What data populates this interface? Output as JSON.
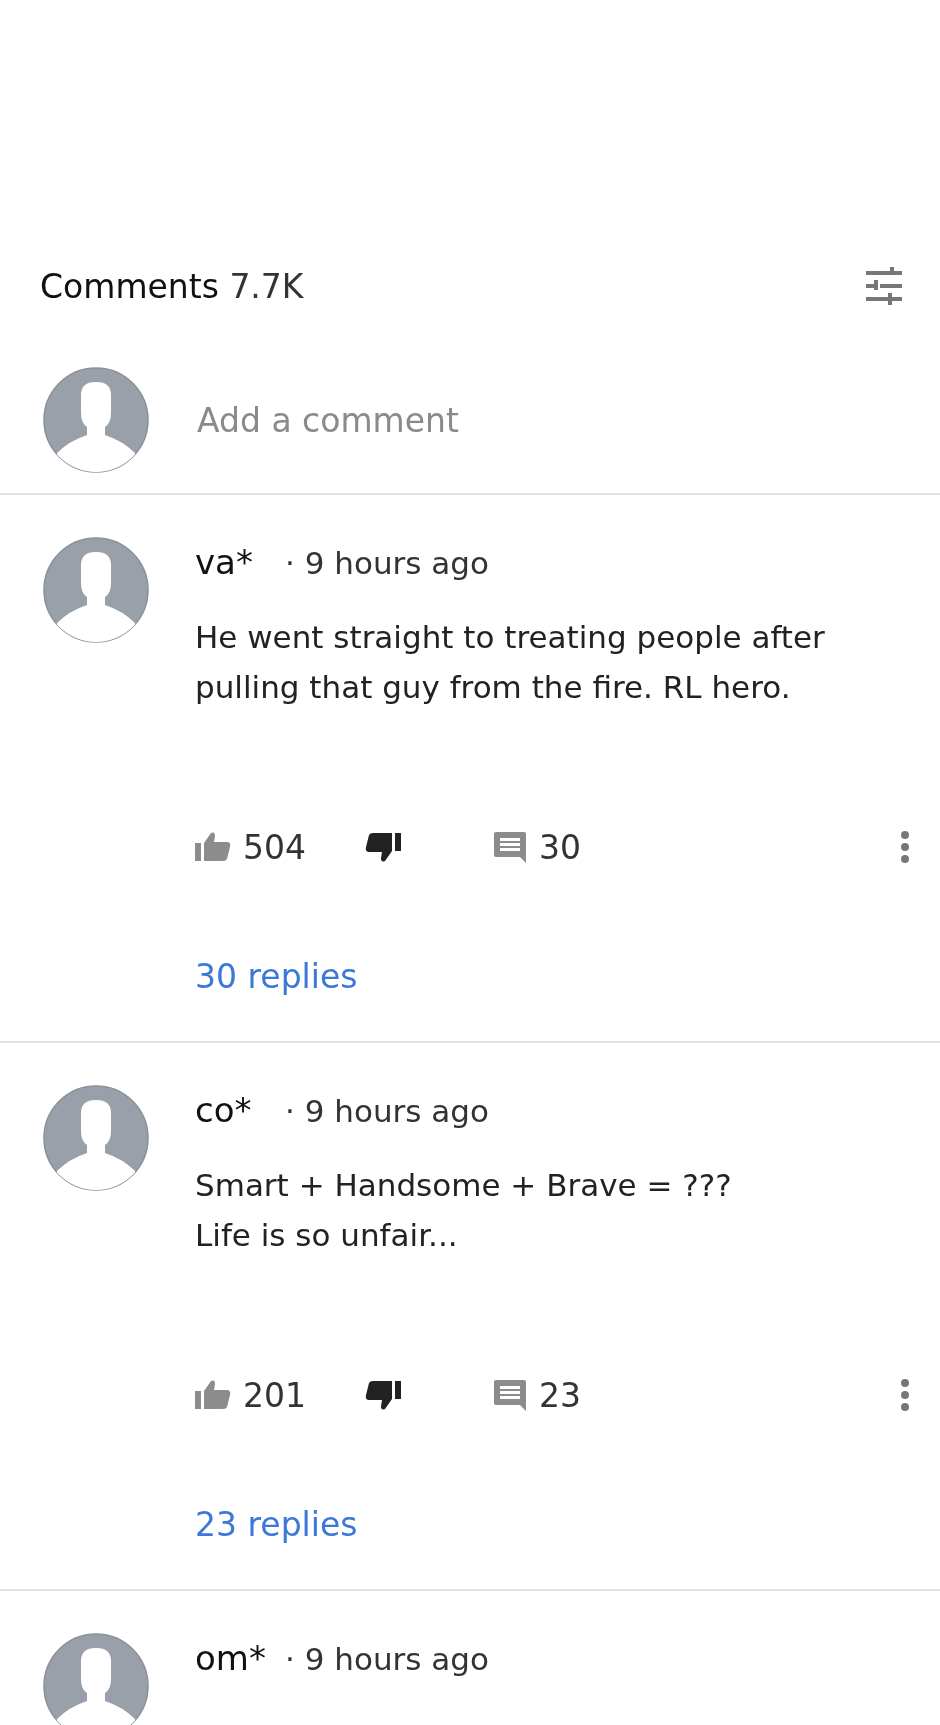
{
  "header": {
    "title": "Comments",
    "count": "7.7K"
  },
  "composer": {
    "placeholder": "Add a comment"
  },
  "comments": [
    {
      "author": "va*",
      "time": "· 9 hours ago",
      "text": "He went straight to treating people after pulling that guy from the fire. RL hero.",
      "likes": "504",
      "reply_count": "30",
      "replies_link": "30 replies"
    },
    {
      "author": "co*",
      "time": "· 9 hours ago",
      "text": "Smart + Handsome + Brave = ???\nLife is so unfair...",
      "likes": "201",
      "reply_count": "23",
      "replies_link": "23 replies"
    },
    {
      "author": "om*",
      "time": "· 9 hours ago"
    }
  ]
}
